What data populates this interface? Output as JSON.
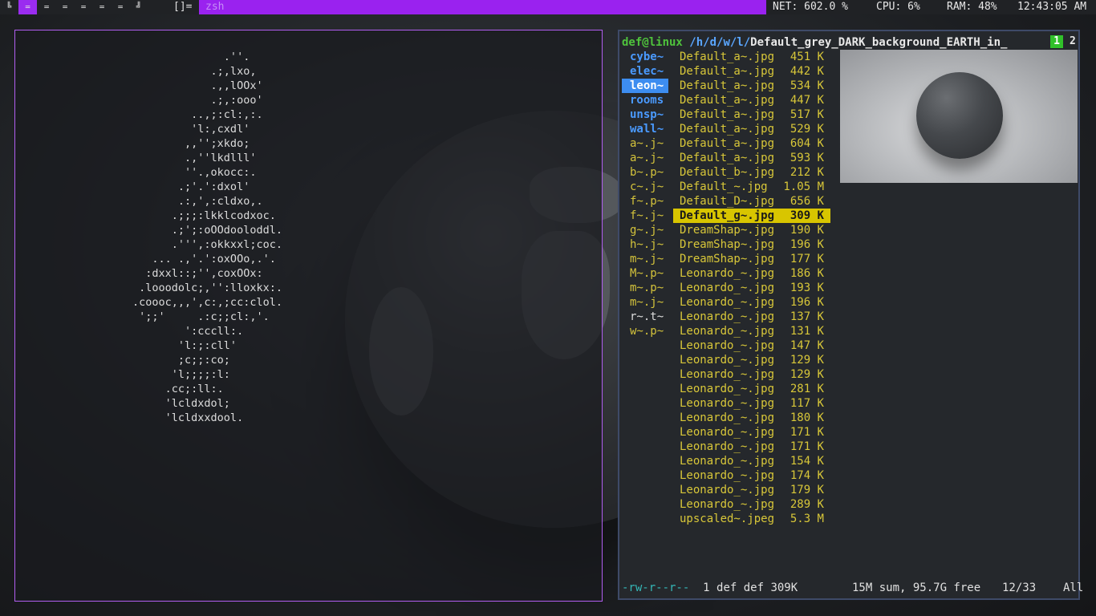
{
  "topbar": {
    "workspaces": [
      "╚",
      "=",
      "=",
      "=",
      "=",
      "=",
      "=",
      "╝"
    ],
    "layout": "[]=",
    "window_title": "zsh",
    "net": "NET: 602.0 %",
    "cpu": "CPU: 6%",
    "ram": "RAM: 48%",
    "clock": "12:43:05 AM"
  },
  "ascii_art": [
    "                      .''.",
    "                    .;,lxo,",
    "                    .,,lOOx'",
    "                    .;,:ooo'",
    "                 ..,;:cl:,:.",
    "                 'l:,cxdl'",
    "                ,,'';xkdo;",
    "                .,''lkdlll'",
    "                ''.,okocc:.",
    "               .;'.':dxol'",
    "               .:,',:cldxo,.",
    "              .;;;:lkklcodxoc.",
    "              .;';:oOOdooloddl.",
    "              .''',:okkxxl;coc.",
    "           ... .,'.':oxOOo,.'.",
    "          :dxxl::;'',coxOOx:",
    "         .looodolc;,'':lloxkx:.",
    "        .coooc,,,',c:,;cc:clol.",
    "         ';;'     .:c;;cl:,'.",
    "                ':cccll:.",
    "               'l:;:cll'",
    "               ;c;;:co;",
    "              'l;;;;:l:",
    "             .cc;:ll:.",
    "             'lcldxdol;",
    "             'lcldxxdool."
  ],
  "ranger": {
    "user_host": "def@linux",
    "path": "/h/d/w/l/",
    "current_file": "Default_grey_DARK_background_EARTH_in_",
    "tabs": [
      "1",
      "2"
    ],
    "parent_column": [
      {
        "name": "cybe~",
        "type": "dir"
      },
      {
        "name": "elec~",
        "type": "dir"
      },
      {
        "name": "leon~",
        "type": "dir",
        "selected": true
      },
      {
        "name": "rooms",
        "type": "dir"
      },
      {
        "name": "unsp~",
        "type": "dir"
      },
      {
        "name": "wall~",
        "type": "dir"
      },
      {
        "name": "a~.j~",
        "type": "file"
      },
      {
        "name": "a~.j~",
        "type": "file"
      },
      {
        "name": "b~.p~",
        "type": "file"
      },
      {
        "name": "c~.j~",
        "type": "file"
      },
      {
        "name": "f~.p~",
        "type": "file"
      },
      {
        "name": "f~.j~",
        "type": "file"
      },
      {
        "name": "g~.j~",
        "type": "file"
      },
      {
        "name": "h~.j~",
        "type": "file"
      },
      {
        "name": "m~.j~",
        "type": "file"
      },
      {
        "name": "M~.p~",
        "type": "file"
      },
      {
        "name": "m~.p~",
        "type": "file"
      },
      {
        "name": "m~.j~",
        "type": "file"
      },
      {
        "name": "r~.t~",
        "type": "plain"
      },
      {
        "name": "w~.p~",
        "type": "file"
      }
    ],
    "files": [
      {
        "name": "Default_a~.jpg",
        "size": "451 K"
      },
      {
        "name": "Default_a~.jpg",
        "size": "442 K"
      },
      {
        "name": "Default_a~.jpg",
        "size": "534 K"
      },
      {
        "name": "Default_a~.jpg",
        "size": "447 K"
      },
      {
        "name": "Default_a~.jpg",
        "size": "517 K"
      },
      {
        "name": "Default_a~.jpg",
        "size": "529 K"
      },
      {
        "name": "Default_a~.jpg",
        "size": "604 K"
      },
      {
        "name": "Default_a~.jpg",
        "size": "593 K"
      },
      {
        "name": "Default_b~.jpg",
        "size": "212 K"
      },
      {
        "name": "Default_~.jpg",
        "size": "1.05 M"
      },
      {
        "name": "Default_D~.jpg",
        "size": "656 K"
      },
      {
        "name": "Default_g~.jpg",
        "size": "309 K",
        "selected": true
      },
      {
        "name": "DreamShap~.jpg",
        "size": "190 K"
      },
      {
        "name": "DreamShap~.jpg",
        "size": "196 K"
      },
      {
        "name": "DreamShap~.jpg",
        "size": "177 K"
      },
      {
        "name": "Leonardo_~.jpg",
        "size": "186 K"
      },
      {
        "name": "Leonardo_~.jpg",
        "size": "193 K"
      },
      {
        "name": "Leonardo_~.jpg",
        "size": "196 K"
      },
      {
        "name": "Leonardo_~.jpg",
        "size": "137 K"
      },
      {
        "name": "Leonardo_~.jpg",
        "size": "131 K"
      },
      {
        "name": "Leonardo_~.jpg",
        "size": "147 K"
      },
      {
        "name": "Leonardo_~.jpg",
        "size": "129 K"
      },
      {
        "name": "Leonardo_~.jpg",
        "size": "129 K"
      },
      {
        "name": "Leonardo_~.jpg",
        "size": "281 K"
      },
      {
        "name": "Leonardo_~.jpg",
        "size": "117 K"
      },
      {
        "name": "Leonardo_~.jpg",
        "size": "180 K"
      },
      {
        "name": "Leonardo_~.jpg",
        "size": "171 K"
      },
      {
        "name": "Leonardo_~.jpg",
        "size": "171 K"
      },
      {
        "name": "Leonardo_~.jpg",
        "size": "154 K"
      },
      {
        "name": "Leonardo_~.jpg",
        "size": "174 K"
      },
      {
        "name": "Leonardo_~.jpg",
        "size": "179 K"
      },
      {
        "name": "Leonardo_~.jpg",
        "size": "289 K"
      },
      {
        "name": "upscaled~.jpeg",
        "size": "5.3 M"
      }
    ],
    "status": {
      "permissions": "-rw-r--r--",
      "info": "1 def def 309K",
      "disk": "15M sum, 95.7G free",
      "position": "12/33",
      "scroll": "All"
    }
  },
  "colors": {
    "accent_purple": "#9a22ef",
    "terminal_border": "#b15ef0",
    "ranger_border": "#3e4a68",
    "selection_yellow": "#d8c500",
    "dir_blue": "#4a9aff",
    "user_green": "#4fc33c"
  }
}
